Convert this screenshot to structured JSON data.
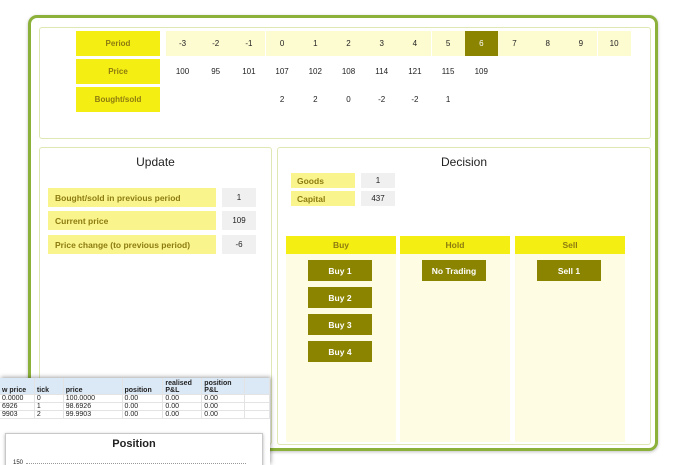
{
  "periods_table": {
    "labels": {
      "period": "Period",
      "price": "Price",
      "bought_sold": "Bought/sold"
    },
    "periods": [
      "-3",
      "-2",
      "-1",
      "0",
      "1",
      "2",
      "3",
      "4",
      "5",
      "6",
      "7",
      "8",
      "9",
      "10"
    ],
    "prices": [
      "100",
      "95",
      "101",
      "107",
      "102",
      "108",
      "114",
      "121",
      "115",
      "109",
      "",
      "",
      "",
      ""
    ],
    "bought_sold": [
      "",
      "",
      "",
      "2",
      "2",
      "0",
      "-2",
      "-2",
      "1",
      "",
      "",
      "",
      "",
      ""
    ],
    "current_period": "6"
  },
  "update": {
    "title": "Update",
    "rows": [
      {
        "label": "Bought/sold in previous period",
        "value": "1"
      },
      {
        "label": "Current price",
        "value": "109"
      },
      {
        "label": "Price change (to previous period)",
        "value": "-6"
      }
    ]
  },
  "decision": {
    "title": "Decision",
    "status": [
      {
        "label": "Goods",
        "value": "1"
      },
      {
        "label": "Capital",
        "value": "437"
      }
    ],
    "columns": [
      {
        "header": "Buy",
        "buttons": [
          "Buy 1",
          "Buy 2",
          "Buy 3",
          "Buy 4"
        ]
      },
      {
        "header": "Hold",
        "buttons": [
          "No Trading"
        ]
      },
      {
        "header": "Sell",
        "buttons": [
          "Sell 1"
        ]
      }
    ]
  },
  "spreadsheet": {
    "headers": [
      "w price",
      "tick",
      "price",
      "position",
      "realised P&L",
      "position P&L"
    ],
    "rows": [
      [
        "0.0000",
        "0",
        "100.0000",
        "0.00",
        "0.00",
        "0.00"
      ],
      [
        "6926",
        "1",
        "98.6926",
        "0.00",
        "0.00",
        "0.00"
      ],
      [
        "9903",
        "2",
        "99.9903",
        "0.00",
        "0.00",
        "0.00"
      ]
    ],
    "chart_title": "Position",
    "chart_ytick": "150"
  },
  "colors": {
    "accent_dark": "#8b8400",
    "yellow": "#f5ee12",
    "frame_green": "#8bb13a"
  }
}
